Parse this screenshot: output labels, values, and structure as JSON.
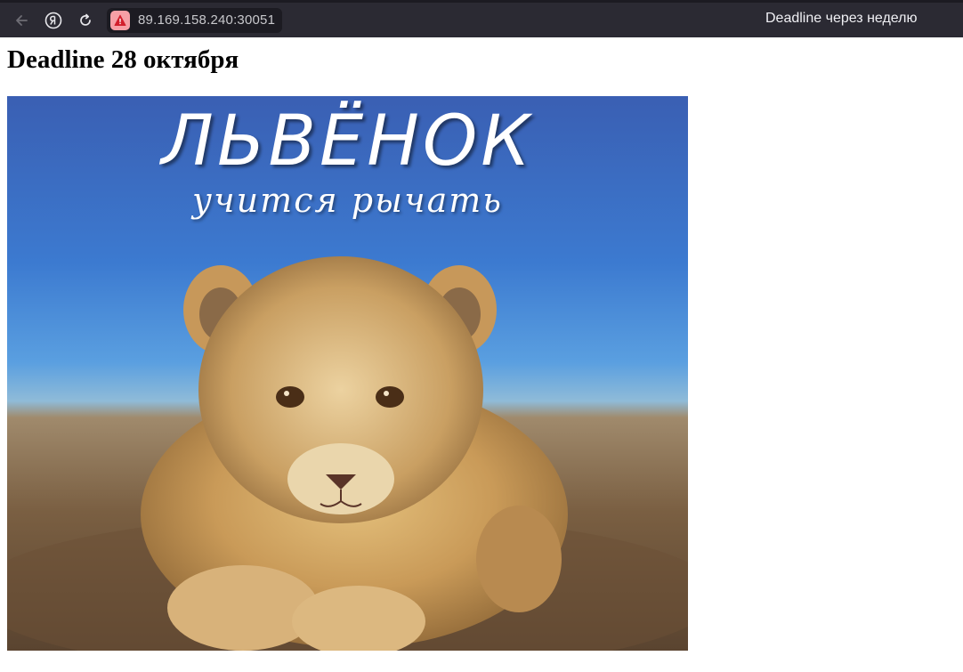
{
  "browser": {
    "url": "89.169.158.240:30051",
    "tab_title": "Deadline через неделю",
    "icons": [
      "back-arrow-icon",
      "yandex-icon",
      "reload-icon",
      "warning-icon"
    ],
    "colors": {
      "toolbar": "#2b2a33",
      "address_bar": "#1c1b22",
      "warning_badge": "#f7a0a6",
      "warning_glyph": "#d21f2c"
    }
  },
  "page": {
    "heading": "Deadline 28 октября",
    "poster": {
      "title": "ЛЬВЁНОК",
      "subtitle": "учится рычать"
    }
  }
}
